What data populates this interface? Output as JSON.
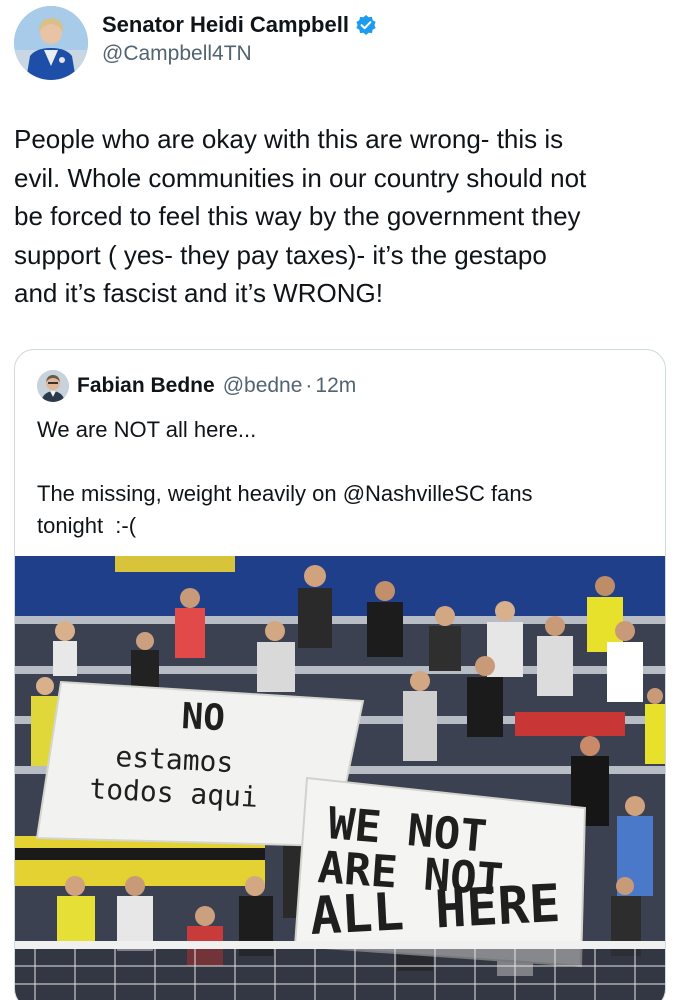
{
  "author": {
    "display_name": "Senator Heidi Campbell",
    "handle": "@Campbell4TN",
    "avatar_icon": "profile-photo",
    "verified_icon": "verified-badge-icon",
    "verified_color": "#1d9bf0"
  },
  "tweet": {
    "text": "People who are okay with this are wrong- this is\nevil. Whole communities in our country should not\nbe forced to feel this way by the government they\nsupport ( yes- they pay taxes)- it’s the gestapo\nand it’s fascist and it’s WRONG!"
  },
  "quoted": {
    "display_name": "Fabian Bedne",
    "handle": "@bedne",
    "separator": "·",
    "time": "12m",
    "text": "We are NOT all here...\n\nThe missing, weight heavily on @NashvilleSC fans\ntonight  :-(",
    "photo": {
      "sign_left_line1": "NO",
      "sign_left_line2": "estamos",
      "sign_left_line3": "todos aqui",
      "sign_right_line1": "WE NOT",
      "sign_right_line2": "ARE NOT",
      "sign_right_line3": "ALL HERE"
    }
  }
}
